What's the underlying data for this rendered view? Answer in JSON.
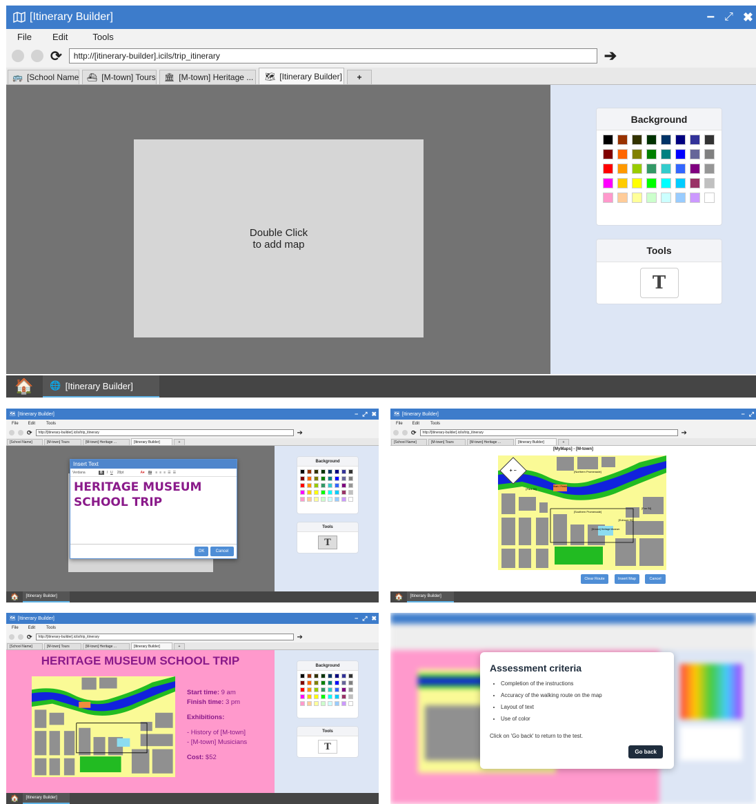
{
  "app": {
    "title": "[Itinerary Builder]",
    "menu": [
      "File",
      "Edit",
      "Tools"
    ],
    "url": "http://[itinerary-builder].icils/trip_itinerary",
    "tabs": [
      "[School Name]",
      "[M-town] Tours",
      "[M-town] Heritage ...",
      "[Itinerary Builder]",
      "+"
    ],
    "taskbar_label": "[Itinerary Builder]"
  },
  "panel": {
    "background_title": "Background",
    "tools_title": "Tools",
    "text_tool_glyph": "T",
    "palette": [
      [
        "#000000",
        "#993300",
        "#333300",
        "#003300",
        "#003366",
        "#000080",
        "#333399",
        "#333333"
      ],
      [
        "#800000",
        "#ff6600",
        "#808000",
        "#008000",
        "#008080",
        "#0000ff",
        "#666699",
        "#808080"
      ],
      [
        "#ff0000",
        "#ff9900",
        "#99cc00",
        "#339966",
        "#33cccc",
        "#3366ff",
        "#800080",
        "#969696"
      ],
      [
        "#ff00ff",
        "#ffcc00",
        "#ffff00",
        "#00ff00",
        "#00ffff",
        "#00ccff",
        "#993366",
        "#c0c0c0"
      ],
      [
        "#ff99cc",
        "#ffcc99",
        "#ffff99",
        "#ccffcc",
        "#ccffff",
        "#99ccff",
        "#cc99ff",
        "#ffffff"
      ]
    ]
  },
  "main": {
    "placeholder_line1": "Double Click",
    "placeholder_line2": "to add map"
  },
  "insert_text": {
    "title": "Insert Text",
    "font": "Verdana",
    "size": "28pt",
    "bold": "B",
    "italic": "I",
    "underline": "U",
    "text_line1": "HERITAGE MUSEUM",
    "text_line2": "SCHOOL TRIP",
    "ok": "OK",
    "cancel": "Cancel"
  },
  "mymaps": {
    "title": "[MyMaps] - [M-town]",
    "clear_route": "Clear Route",
    "insert_map": "Insert Map",
    "cancel": "Cancel",
    "labels": {
      "northern_promenade": "[Northern Promenade]",
      "southern_promenade": "[Southern Promenade]",
      "park_st": "[Park St]",
      "fox_st": "[Fox St]",
      "edmont_st": "[Edmont St]",
      "start_finish": "Start / Finish",
      "museum": "[M-town] Heritage Museum"
    }
  },
  "itinerary": {
    "heading": "HERITAGE MUSEUM SCHOOL TRIP",
    "start_label": "Start time:",
    "start_value": "9 am",
    "finish_label": "Finish time:",
    "finish_value": "3 pm",
    "exhibitions_label": "Exhibitions:",
    "exhibit1": "- History of [M-town]",
    "exhibit2": "- [M-town] Musicians",
    "cost_label": "Cost:",
    "cost_value": "$52",
    "page_color": "#ff99cc"
  },
  "assessment": {
    "title": "Assessment criteria",
    "items": [
      "Completion of the instructions",
      "Accuracy of the walking route on the map",
      "Layout of text",
      "Use of color"
    ],
    "note": "Click on 'Go back' to return to the test.",
    "go_back": "Go back"
  }
}
